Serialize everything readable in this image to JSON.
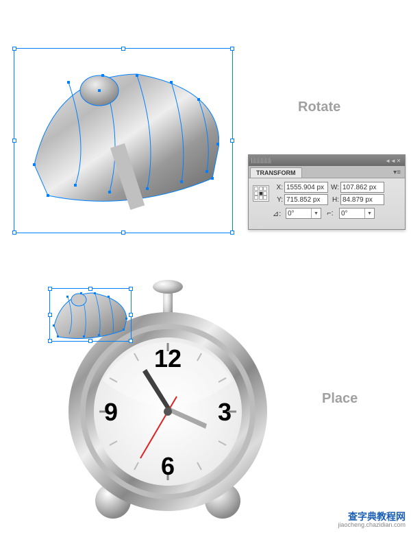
{
  "labels": {
    "rotate": "Rotate",
    "place": "Place"
  },
  "transform_panel": {
    "title": "TRANSFORM",
    "x_label": "X:",
    "y_label": "Y:",
    "w_label": "W:",
    "h_label": "H:",
    "x_value": "1555.904 px",
    "y_value": "715.852 px",
    "w_value": "107.862 px",
    "h_value": "84.879 px",
    "rotate_angle": "0°",
    "shear_angle": "0°"
  },
  "clock": {
    "numerals": {
      "n12": "12",
      "n3": "3",
      "n6": "6",
      "n9": "9"
    }
  },
  "watermark": {
    "main": "查字典教程网",
    "url": "jiaocheng.chazidian.com"
  }
}
